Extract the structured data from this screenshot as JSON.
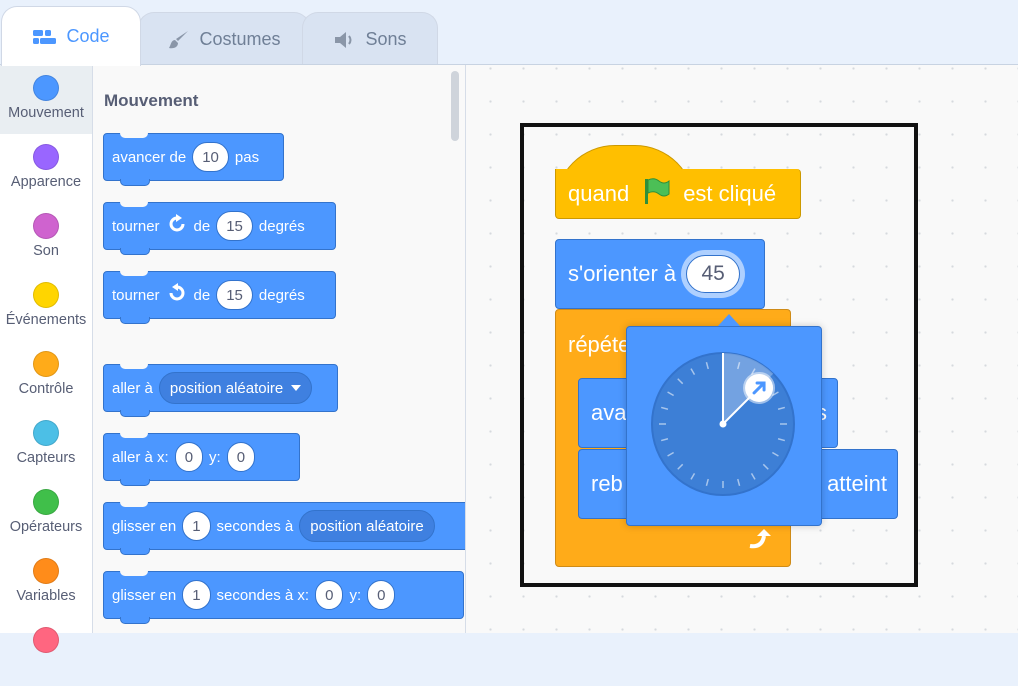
{
  "tabs": [
    {
      "label": "Code",
      "icon": "code-icon"
    },
    {
      "label": "Costumes",
      "icon": "brush-icon"
    },
    {
      "label": "Sons",
      "icon": "speaker-icon"
    }
  ],
  "categories": [
    {
      "label": "Mouvement",
      "color": "#4c97ff"
    },
    {
      "label": "Apparence",
      "color": "#9966ff"
    },
    {
      "label": "Son",
      "color": "#cf63cf"
    },
    {
      "label": "Événements",
      "color": "#ffd500"
    },
    {
      "label": "Contrôle",
      "color": "#ffab19"
    },
    {
      "label": "Capteurs",
      "color": "#4cbfe6"
    },
    {
      "label": "Opérateurs",
      "color": "#40bf4a"
    },
    {
      "label": "Variables",
      "color": "#ff8c1a"
    }
  ],
  "palette": {
    "title": "Mouvement",
    "move": {
      "pre": "avancer de",
      "value": "10",
      "post": "pas"
    },
    "turn_right": {
      "pre": "tourner",
      "mid": "de",
      "value": "15",
      "post": "degrés"
    },
    "turn_left": {
      "pre": "tourner",
      "mid": "de",
      "value": "15",
      "post": "degrés"
    },
    "goto": {
      "pre": "aller à",
      "option": "position aléatoire"
    },
    "goto_xy": {
      "pre": "aller à x:",
      "x": "0",
      "mid": "y:",
      "y": "0"
    },
    "glide": {
      "pre": "glisser en",
      "secs": "1",
      "mid": "secondes à",
      "option": "position aléatoire"
    },
    "glide_xy": {
      "pre": "glisser en",
      "secs": "1",
      "mid": "secondes à x:",
      "x": "0",
      "mid2": "y:",
      "y": "0"
    }
  },
  "script": {
    "hat": {
      "pre": "quand",
      "post": "est cliqué"
    },
    "point": {
      "label": "s'orienter à",
      "value": "45"
    },
    "repeat_label": "répéte",
    "inner1_left": "ava",
    "inner1_right": "s",
    "inner2_left": "reb",
    "inner2_right": "atteint"
  },
  "dial": {
    "value": 45
  }
}
